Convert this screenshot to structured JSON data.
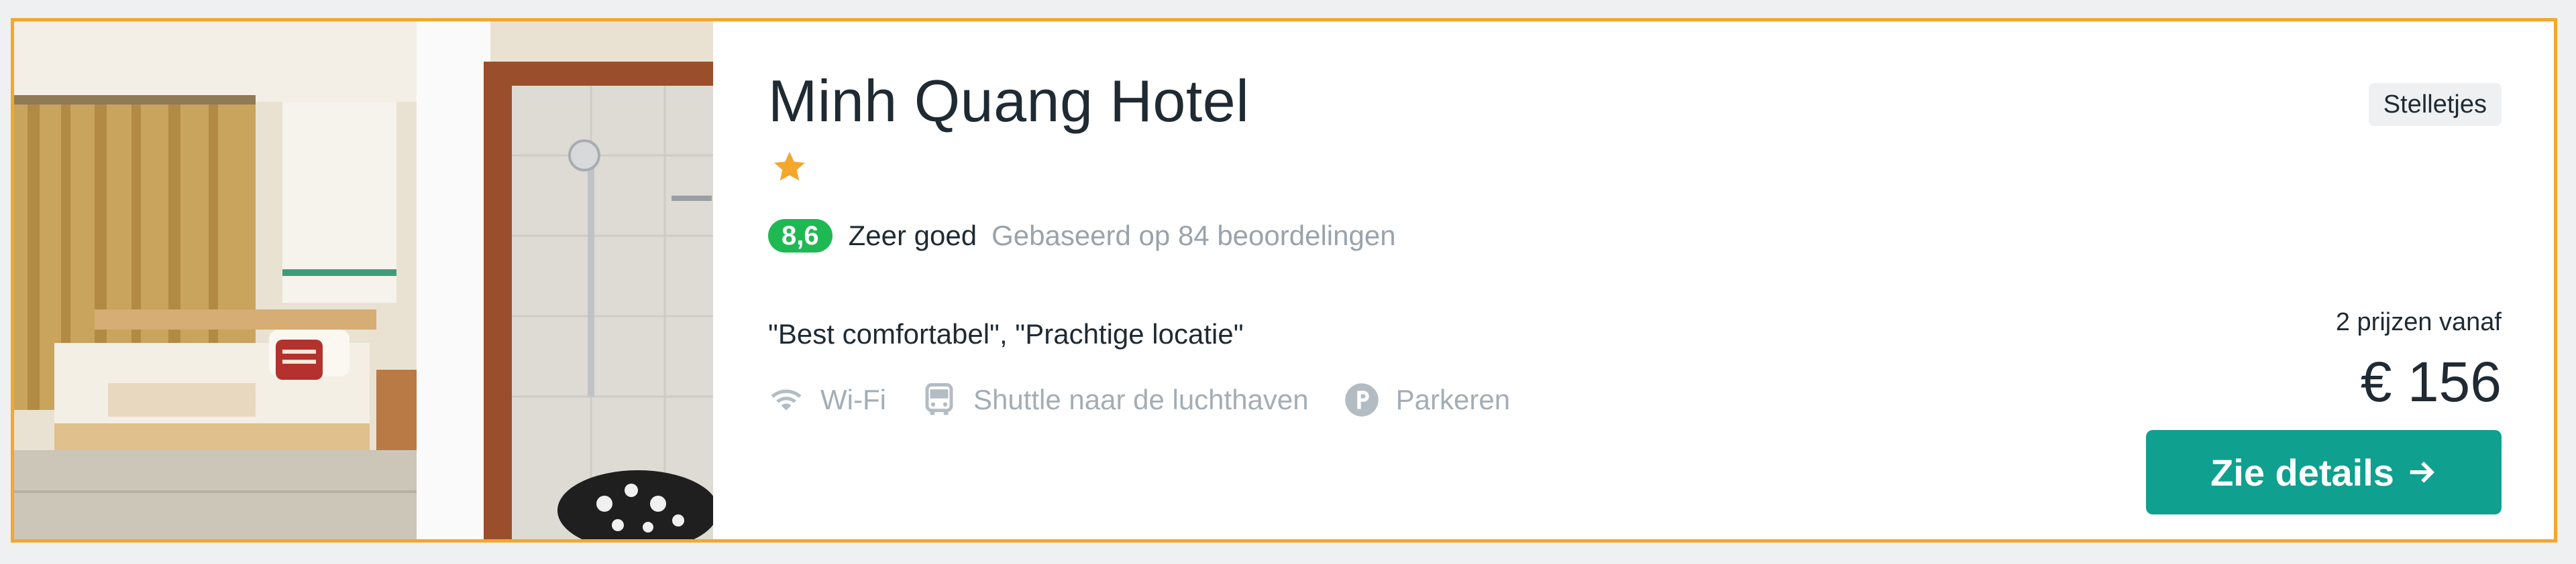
{
  "hotel": {
    "name": "Minh Quang Hotel",
    "star_count": 1,
    "tag": "Stelletjes"
  },
  "rating": {
    "score": "8,6",
    "label": "Zeer goed",
    "count_text": "Gebaseerd op 84 beoordelingen"
  },
  "quotes": "\"Best comfortabel\", \"Prachtige locatie\"",
  "amenities": [
    {
      "icon": "wifi-icon",
      "label": "Wi-Fi"
    },
    {
      "icon": "shuttle-bus-icon",
      "label": "Shuttle naar de luchthaven"
    },
    {
      "icon": "parking-icon",
      "label": "Parkeren"
    }
  ],
  "pricing": {
    "from_text": "2 prijzen vanaf",
    "price": "€ 156"
  },
  "button": {
    "label": "Zie details",
    "icon": "arrow-right-icon"
  },
  "colors": {
    "border": "#f3a72c",
    "score_badge": "#1fb954",
    "button": "#0fa08f",
    "star": "#f3a72c"
  }
}
